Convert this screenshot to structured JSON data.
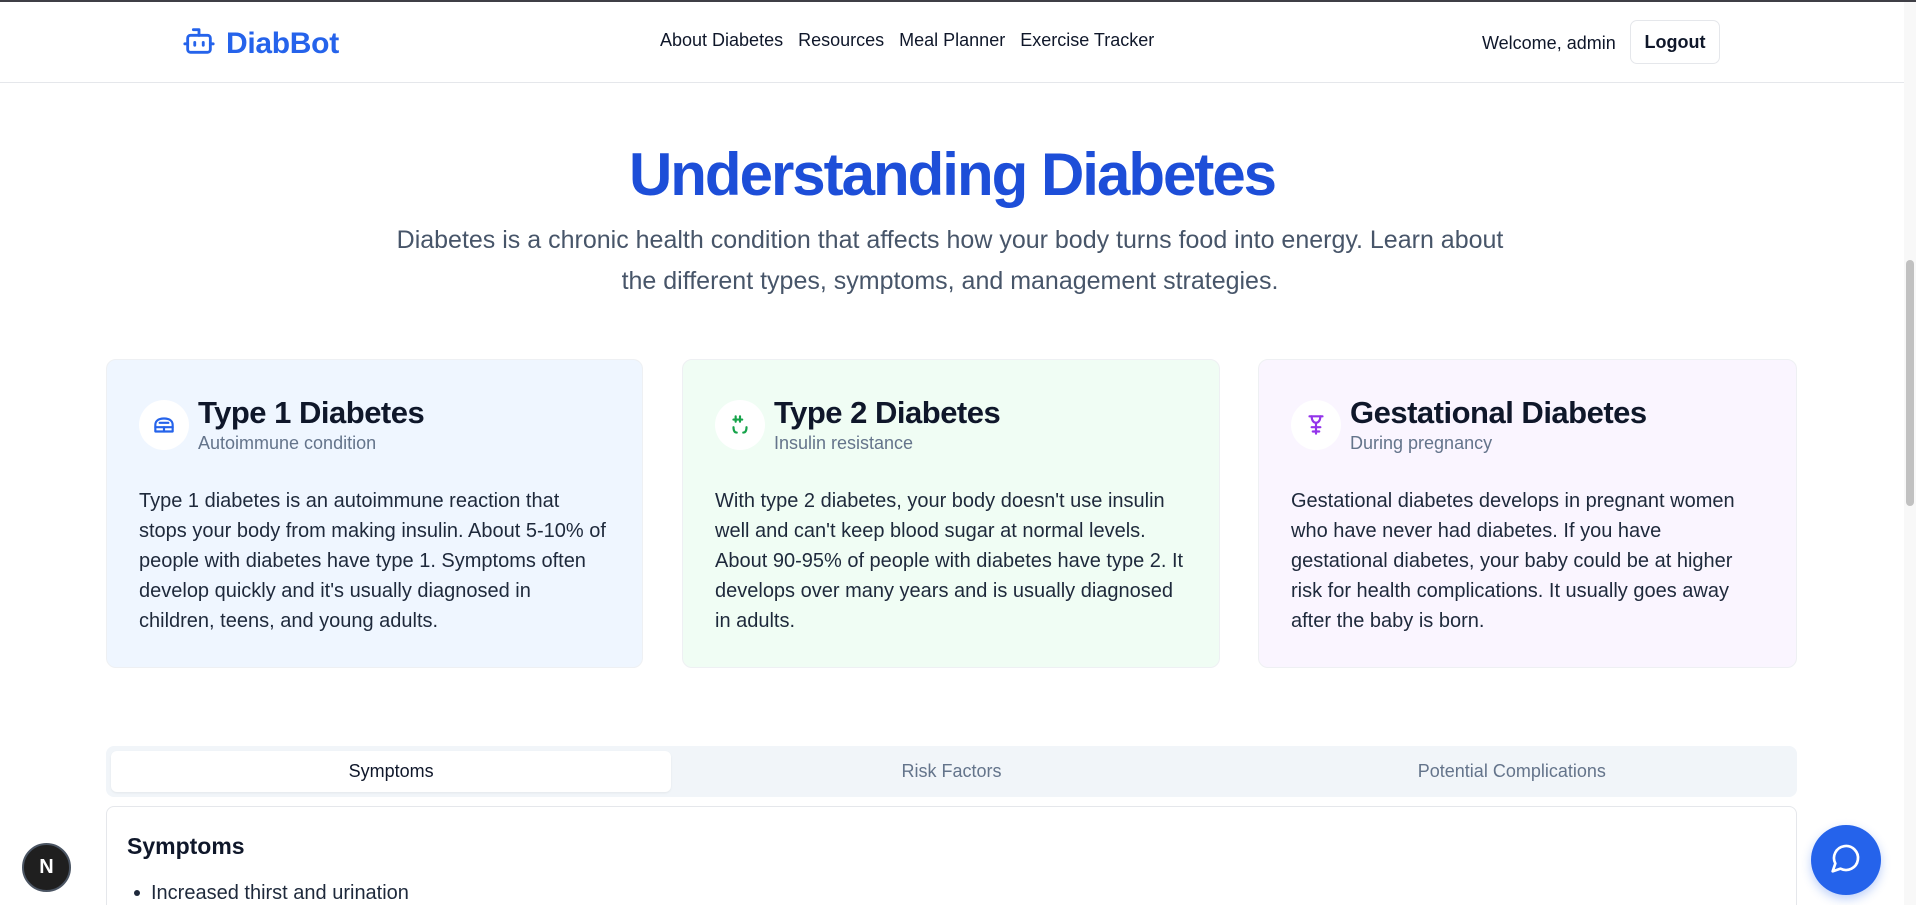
{
  "header": {
    "logo_text": "DiabBot",
    "nav": [
      "About Diabetes",
      "Resources",
      "Meal Planner",
      "Exercise Tracker"
    ],
    "welcome": "Welcome, admin",
    "logout": "Logout"
  },
  "hero": {
    "title": "Understanding Diabetes",
    "subtitle": "Diabetes is a chronic health condition that affects how your body turns food into energy. Learn about the different types, symptoms, and management strategies."
  },
  "cards": [
    {
      "title": "Type 1 Diabetes",
      "subtitle": "Autoimmune condition",
      "body": "Type 1 diabetes is an autoimmune reaction that stops your body from making insulin. About 5-10% of people with diabetes have type 1. Symptoms often develop quickly and it's usually diagnosed in children, teens, and young adults.",
      "icon": "syringe-icon",
      "icon_color": "#2563eb"
    },
    {
      "title": "Type 2 Diabetes",
      "subtitle": "Insulin resistance",
      "body": "With type 2 diabetes, your body doesn't use insulin well and can't keep blood sugar at normal levels. About 90-95% of people with diabetes have type 2. It develops over many years and is usually diagnosed in adults.",
      "icon": "activity-icon",
      "icon_color": "#16a34a"
    },
    {
      "title": "Gestational Diabetes",
      "subtitle": "During pregnancy",
      "body": "Gestational diabetes develops in pregnant women who have never had diabetes. If you have gestational diabetes, your baby could be at higher risk for health complications. It usually goes away after the baby is born.",
      "icon": "baby-icon",
      "icon_color": "#9333ea"
    }
  ],
  "tabs": [
    "Symptoms",
    "Risk Factors",
    "Potential Complications"
  ],
  "active_tab": "Symptoms",
  "panel": {
    "title": "Symptoms",
    "items": [
      "Increased thirst and urination"
    ]
  },
  "dev_badge": "N",
  "colors": {
    "primary": "#2563eb",
    "hero_title": "#1d4ed8",
    "card1_bg": "#eff6ff",
    "card2_bg": "#f0fdf4",
    "card3_bg": "#faf5ff"
  }
}
